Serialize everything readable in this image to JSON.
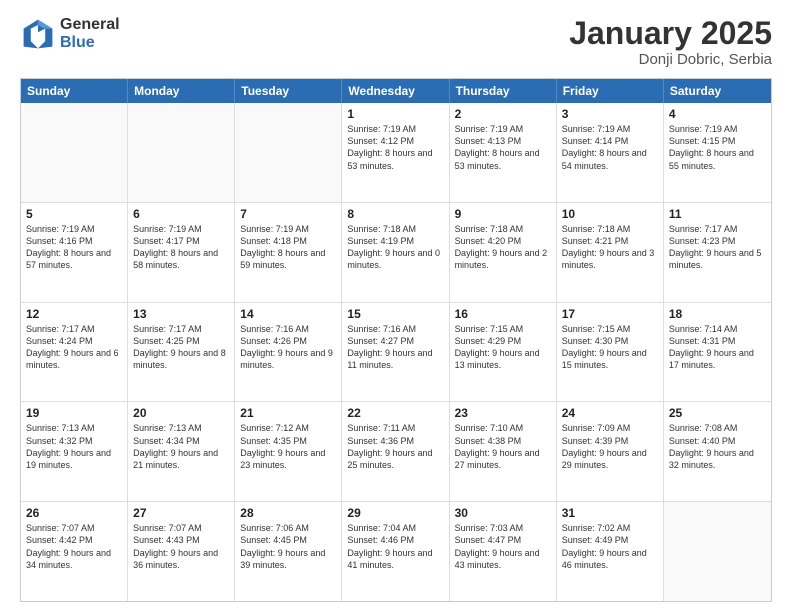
{
  "header": {
    "logo_general": "General",
    "logo_blue": "Blue",
    "month_title": "January 2025",
    "location": "Donji Dobric, Serbia"
  },
  "calendar": {
    "days_of_week": [
      "Sunday",
      "Monday",
      "Tuesday",
      "Wednesday",
      "Thursday",
      "Friday",
      "Saturday"
    ],
    "rows": [
      [
        {
          "day": "",
          "empty": true
        },
        {
          "day": "",
          "empty": true
        },
        {
          "day": "",
          "empty": true
        },
        {
          "day": "1",
          "sunrise": "7:19 AM",
          "sunset": "4:12 PM",
          "daylight": "8 hours and 53 minutes."
        },
        {
          "day": "2",
          "sunrise": "7:19 AM",
          "sunset": "4:13 PM",
          "daylight": "8 hours and 53 minutes."
        },
        {
          "day": "3",
          "sunrise": "7:19 AM",
          "sunset": "4:14 PM",
          "daylight": "8 hours and 54 minutes."
        },
        {
          "day": "4",
          "sunrise": "7:19 AM",
          "sunset": "4:15 PM",
          "daylight": "8 hours and 55 minutes."
        }
      ],
      [
        {
          "day": "5",
          "sunrise": "7:19 AM",
          "sunset": "4:16 PM",
          "daylight": "8 hours and 57 minutes."
        },
        {
          "day": "6",
          "sunrise": "7:19 AM",
          "sunset": "4:17 PM",
          "daylight": "8 hours and 58 minutes."
        },
        {
          "day": "7",
          "sunrise": "7:19 AM",
          "sunset": "4:18 PM",
          "daylight": "8 hours and 59 minutes."
        },
        {
          "day": "8",
          "sunrise": "7:18 AM",
          "sunset": "4:19 PM",
          "daylight": "9 hours and 0 minutes."
        },
        {
          "day": "9",
          "sunrise": "7:18 AM",
          "sunset": "4:20 PM",
          "daylight": "9 hours and 2 minutes."
        },
        {
          "day": "10",
          "sunrise": "7:18 AM",
          "sunset": "4:21 PM",
          "daylight": "9 hours and 3 minutes."
        },
        {
          "day": "11",
          "sunrise": "7:17 AM",
          "sunset": "4:23 PM",
          "daylight": "9 hours and 5 minutes."
        }
      ],
      [
        {
          "day": "12",
          "sunrise": "7:17 AM",
          "sunset": "4:24 PM",
          "daylight": "9 hours and 6 minutes."
        },
        {
          "day": "13",
          "sunrise": "7:17 AM",
          "sunset": "4:25 PM",
          "daylight": "9 hours and 8 minutes."
        },
        {
          "day": "14",
          "sunrise": "7:16 AM",
          "sunset": "4:26 PM",
          "daylight": "9 hours and 9 minutes."
        },
        {
          "day": "15",
          "sunrise": "7:16 AM",
          "sunset": "4:27 PM",
          "daylight": "9 hours and 11 minutes."
        },
        {
          "day": "16",
          "sunrise": "7:15 AM",
          "sunset": "4:29 PM",
          "daylight": "9 hours and 13 minutes."
        },
        {
          "day": "17",
          "sunrise": "7:15 AM",
          "sunset": "4:30 PM",
          "daylight": "9 hours and 15 minutes."
        },
        {
          "day": "18",
          "sunrise": "7:14 AM",
          "sunset": "4:31 PM",
          "daylight": "9 hours and 17 minutes."
        }
      ],
      [
        {
          "day": "19",
          "sunrise": "7:13 AM",
          "sunset": "4:32 PM",
          "daylight": "9 hours and 19 minutes."
        },
        {
          "day": "20",
          "sunrise": "7:13 AM",
          "sunset": "4:34 PM",
          "daylight": "9 hours and 21 minutes."
        },
        {
          "day": "21",
          "sunrise": "7:12 AM",
          "sunset": "4:35 PM",
          "daylight": "9 hours and 23 minutes."
        },
        {
          "day": "22",
          "sunrise": "7:11 AM",
          "sunset": "4:36 PM",
          "daylight": "9 hours and 25 minutes."
        },
        {
          "day": "23",
          "sunrise": "7:10 AM",
          "sunset": "4:38 PM",
          "daylight": "9 hours and 27 minutes."
        },
        {
          "day": "24",
          "sunrise": "7:09 AM",
          "sunset": "4:39 PM",
          "daylight": "9 hours and 29 minutes."
        },
        {
          "day": "25",
          "sunrise": "7:08 AM",
          "sunset": "4:40 PM",
          "daylight": "9 hours and 32 minutes."
        }
      ],
      [
        {
          "day": "26",
          "sunrise": "7:07 AM",
          "sunset": "4:42 PM",
          "daylight": "9 hours and 34 minutes."
        },
        {
          "day": "27",
          "sunrise": "7:07 AM",
          "sunset": "4:43 PM",
          "daylight": "9 hours and 36 minutes."
        },
        {
          "day": "28",
          "sunrise": "7:06 AM",
          "sunset": "4:45 PM",
          "daylight": "9 hours and 39 minutes."
        },
        {
          "day": "29",
          "sunrise": "7:04 AM",
          "sunset": "4:46 PM",
          "daylight": "9 hours and 41 minutes."
        },
        {
          "day": "30",
          "sunrise": "7:03 AM",
          "sunset": "4:47 PM",
          "daylight": "9 hours and 43 minutes."
        },
        {
          "day": "31",
          "sunrise": "7:02 AM",
          "sunset": "4:49 PM",
          "daylight": "9 hours and 46 minutes."
        },
        {
          "day": "",
          "empty": true
        }
      ]
    ]
  }
}
